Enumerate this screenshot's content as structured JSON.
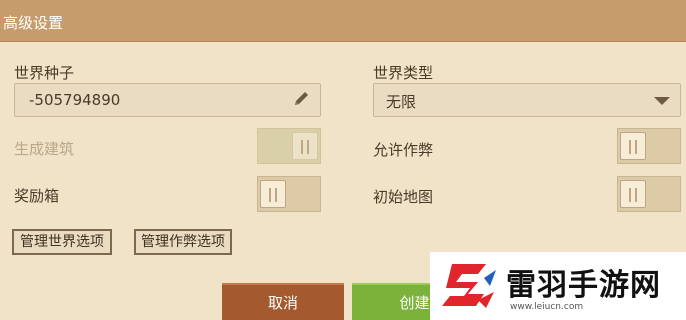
{
  "dialog": {
    "title": "高级设置"
  },
  "world_seed": {
    "label": "世界种子",
    "value": "-505794890",
    "edit_icon": "pencil-icon"
  },
  "world_type": {
    "label": "世界类型",
    "selected": "无限",
    "dropdown_icon": "chevron-down-icon"
  },
  "toggles": {
    "generate_structures": {
      "label": "生成建筑",
      "state": "on",
      "enabled": false
    },
    "allow_cheats": {
      "label": "允许作弊",
      "state": "off",
      "enabled": true
    },
    "bonus_chest": {
      "label": "奖励箱",
      "state": "off",
      "enabled": true
    },
    "starting_map": {
      "label": "初始地图",
      "state": "off",
      "enabled": true
    }
  },
  "buttons": {
    "manage_world_options": "管理世界选项",
    "manage_cheat_options": "管理作弊选项",
    "cancel": "取消",
    "create": "创建"
  },
  "watermark": {
    "name": "雷羽手游网",
    "url": "www.leiucn.com"
  },
  "colors": {
    "title_bar": "#c79c6c",
    "background": "#f0e3c8",
    "cancel_button": "#a45a2e",
    "create_button": "#7bb23a",
    "watermark_logo": "#e0262c"
  }
}
